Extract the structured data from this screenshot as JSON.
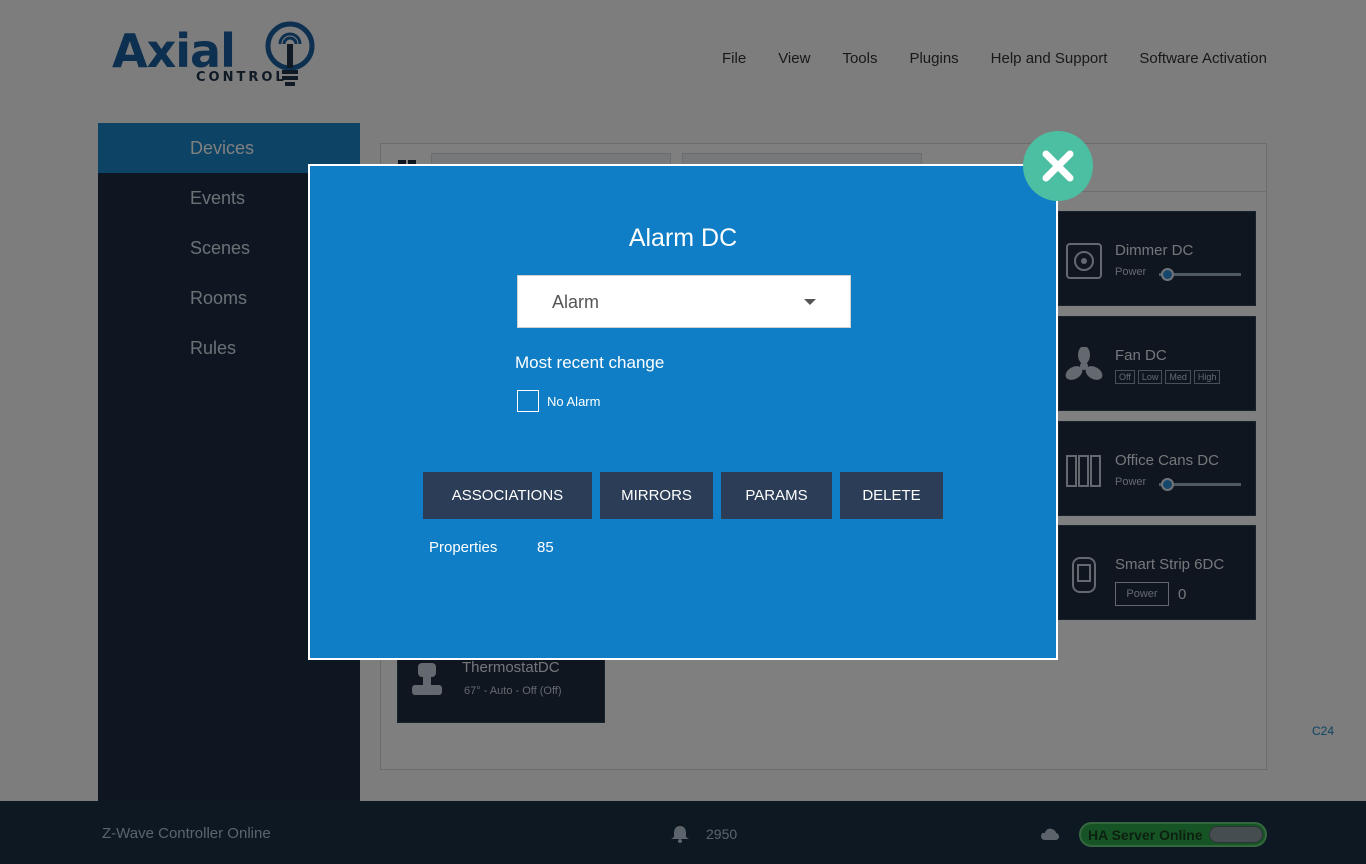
{
  "brand": {
    "name": "Axial",
    "tagline": "CONTROL",
    "accent": "#1a5fa0"
  },
  "menu": [
    "File",
    "View",
    "Tools",
    "Plugins",
    "Help and Support",
    "Software Activation"
  ],
  "sidebar": {
    "items": [
      {
        "label": "Devices",
        "active": true
      },
      {
        "label": "Events",
        "active": false
      },
      {
        "label": "Scenes",
        "active": false
      },
      {
        "label": "Rooms",
        "active": false
      },
      {
        "label": "Rules",
        "active": false
      }
    ]
  },
  "devices": [
    {
      "name": "Dimmer DC",
      "icon": "dimmer-icon",
      "control": "Power"
    },
    {
      "name": "Fan DC",
      "icon": "fan-icon",
      "speeds": [
        "Off",
        "Low",
        "Med",
        "High"
      ]
    },
    {
      "name": "Office Cans DC",
      "icon": "light-bank-icon",
      "control": "Power"
    },
    {
      "name": "Smart Strip 6DC",
      "icon": "power-strip-icon",
      "control": "Power",
      "value": "0"
    },
    {
      "name": "ThermostatDC",
      "icon": "thermostat-icon",
      "status": "67° - Auto - Off (Off)"
    }
  ],
  "corner_label": "C24",
  "footer": {
    "status": "Z-Wave Controller Online",
    "notification_count": "2950",
    "server_status": "HA Server Online",
    "server_color": "#2fa84a"
  },
  "modal": {
    "title": "Alarm DC",
    "select_value": "Alarm",
    "recent_label": "Most recent change",
    "checkbox_label": "No Alarm",
    "checkbox_checked": false,
    "buttons": {
      "associations": "ASSOCIATIONS",
      "mirrors": "MIRRORS",
      "params": "PARAMS",
      "delete": "DELETE"
    },
    "properties_label": "Properties",
    "properties_value": "85",
    "background": "#0f7ec6",
    "close_color": "#4cbea1"
  }
}
